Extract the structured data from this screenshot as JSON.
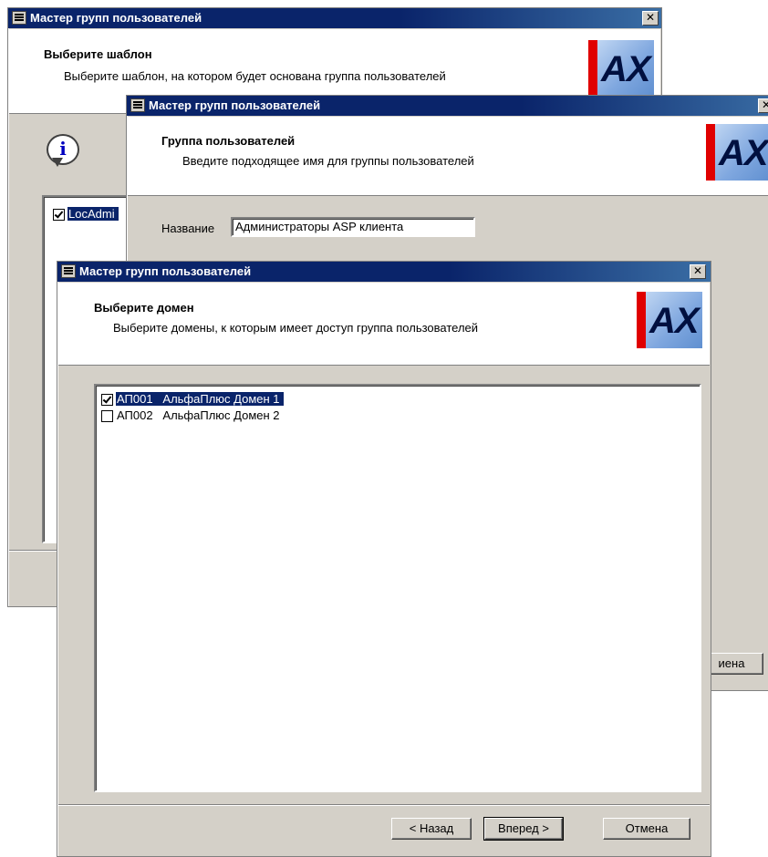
{
  "window1": {
    "title": "Мастер групп пользователей",
    "close": "✕",
    "header_title": "Выберите шаблон",
    "header_sub": "Выберите шаблон, на котором будет основана группа пользователей",
    "logo_text": "AX",
    "info_icon": "i",
    "list_item": "LocAdmi",
    "list_item_checked": true,
    "cancel_label": "иена"
  },
  "window2": {
    "title": "Мастер групп пользователей",
    "close": "✕",
    "header_title": "Группа пользователей",
    "header_sub": "Введите подходящее имя для группы пользователей",
    "logo_text": "AX",
    "name_label": "Название",
    "name_value": "Администраторы ASP клиента"
  },
  "window3": {
    "title": "Мастер групп пользователей",
    "close": "✕",
    "header_title": "Выберите домен",
    "header_sub": "Выберите домены, к которым имеет доступ группа пользователей",
    "logo_text": "AX",
    "domains": [
      {
        "code": "АП001",
        "name": "АльфаПлюс Домен 1",
        "checked": true,
        "selected": true
      },
      {
        "code": "АП002",
        "name": "АльфаПлюс Домен 2",
        "checked": false,
        "selected": false
      }
    ],
    "back_label": "< Назад",
    "next_label": "Вперед >",
    "cancel_label": "Отмена"
  },
  "colors": {
    "titlebar": "#0a246a",
    "selection": "#0a246a",
    "dialog_face": "#d4d0c8",
    "logo_red": "#e00000"
  }
}
